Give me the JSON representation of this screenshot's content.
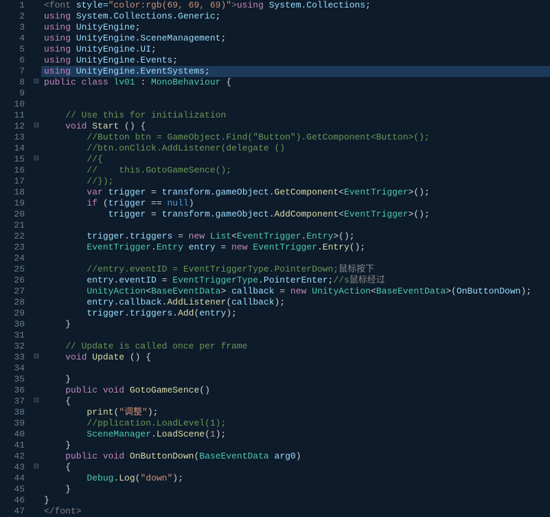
{
  "lines": [
    {
      "num": 1,
      "fold": "",
      "hl": false,
      "segs": [
        [
          "font-tag",
          "<font "
        ],
        [
          "font-attr",
          "style="
        ],
        [
          "font-val",
          "\"color:rgb(69, 69, 69)\""
        ],
        [
          "font-tag",
          ">"
        ],
        [
          "kw",
          "using "
        ],
        [
          "ns",
          "System.Collections"
        ],
        [
          "punc",
          ";"
        ]
      ]
    },
    {
      "num": 2,
      "fold": "",
      "hl": false,
      "segs": [
        [
          "kw",
          "using "
        ],
        [
          "ns",
          "System.Collections.Generic"
        ],
        [
          "punc",
          ";"
        ]
      ]
    },
    {
      "num": 3,
      "fold": "",
      "hl": false,
      "segs": [
        [
          "kw",
          "using "
        ],
        [
          "ns",
          "UnityEngine"
        ],
        [
          "punc",
          ";"
        ]
      ]
    },
    {
      "num": 4,
      "fold": "",
      "hl": false,
      "segs": [
        [
          "kw",
          "using "
        ],
        [
          "ns",
          "UnityEngine.SceneManagement"
        ],
        [
          "punc",
          ";"
        ]
      ]
    },
    {
      "num": 5,
      "fold": "",
      "hl": false,
      "segs": [
        [
          "kw",
          "using "
        ],
        [
          "ns",
          "UnityEngine.UI"
        ],
        [
          "punc",
          ";"
        ]
      ]
    },
    {
      "num": 6,
      "fold": "",
      "hl": false,
      "segs": [
        [
          "kw",
          "using "
        ],
        [
          "ns",
          "UnityEngine.Events"
        ],
        [
          "punc",
          ";"
        ]
      ]
    },
    {
      "num": 7,
      "fold": "",
      "hl": true,
      "segs": [
        [
          "kw",
          "using "
        ],
        [
          "ns",
          "UnityEngine.EventSystems"
        ],
        [
          "punc",
          ";"
        ]
      ]
    },
    {
      "num": 8,
      "fold": "⊟",
      "hl": false,
      "segs": [
        [
          "kw",
          "public class "
        ],
        [
          "type",
          "lv01"
        ],
        [
          "punc",
          " : "
        ],
        [
          "type",
          "MonoBehaviour"
        ],
        [
          "punc",
          " {"
        ]
      ]
    },
    {
      "num": 9,
      "fold": "",
      "hl": false,
      "segs": [
        [
          "punc",
          ""
        ]
      ]
    },
    {
      "num": 10,
      "fold": "",
      "hl": false,
      "segs": [
        [
          "punc",
          ""
        ]
      ]
    },
    {
      "num": 11,
      "fold": "",
      "hl": false,
      "segs": [
        [
          "punc",
          "    "
        ],
        [
          "comment",
          "// Use this for initialization"
        ]
      ]
    },
    {
      "num": 12,
      "fold": "⊟",
      "hl": false,
      "segs": [
        [
          "punc",
          "    "
        ],
        [
          "kw",
          "void "
        ],
        [
          "method",
          "Start"
        ],
        [
          "punc",
          " () {"
        ]
      ]
    },
    {
      "num": 13,
      "fold": "",
      "hl": false,
      "segs": [
        [
          "punc",
          "        "
        ],
        [
          "comment",
          "//Button btn = GameObject.Find(\"Button\").GetComponent<Button>();"
        ]
      ]
    },
    {
      "num": 14,
      "fold": "",
      "hl": false,
      "segs": [
        [
          "punc",
          "        "
        ],
        [
          "comment",
          "//btn.onClick.AddListener(delegate ()"
        ]
      ]
    },
    {
      "num": 15,
      "fold": "⊟",
      "hl": false,
      "segs": [
        [
          "punc",
          "        "
        ],
        [
          "comment",
          "//{"
        ]
      ]
    },
    {
      "num": 16,
      "fold": "",
      "hl": false,
      "segs": [
        [
          "punc",
          "        "
        ],
        [
          "comment",
          "//    this.GotoGameSence();"
        ]
      ]
    },
    {
      "num": 17,
      "fold": "",
      "hl": false,
      "segs": [
        [
          "punc",
          "        "
        ],
        [
          "comment",
          "//});"
        ]
      ]
    },
    {
      "num": 18,
      "fold": "",
      "hl": false,
      "segs": [
        [
          "punc",
          "        "
        ],
        [
          "kw",
          "var "
        ],
        [
          "ns",
          "trigger"
        ],
        [
          "punc",
          " = "
        ],
        [
          "ns",
          "transform"
        ],
        [
          "punc",
          "."
        ],
        [
          "ns",
          "gameObject"
        ],
        [
          "punc",
          "."
        ],
        [
          "method",
          "GetComponent"
        ],
        [
          "punc",
          "<"
        ],
        [
          "type",
          "EventTrigger"
        ],
        [
          "punc",
          ">();"
        ]
      ]
    },
    {
      "num": 19,
      "fold": "",
      "hl": false,
      "segs": [
        [
          "punc",
          "        "
        ],
        [
          "kw",
          "if "
        ],
        [
          "punc",
          "("
        ],
        [
          "ns",
          "trigger"
        ],
        [
          "punc",
          " == "
        ],
        [
          "null",
          "null"
        ],
        [
          "punc",
          ")"
        ]
      ]
    },
    {
      "num": 20,
      "fold": "",
      "hl": false,
      "segs": [
        [
          "punc",
          "            "
        ],
        [
          "ns",
          "trigger"
        ],
        [
          "punc",
          " = "
        ],
        [
          "ns",
          "transform"
        ],
        [
          "punc",
          "."
        ],
        [
          "ns",
          "gameObject"
        ],
        [
          "punc",
          "."
        ],
        [
          "method",
          "AddComponent"
        ],
        [
          "punc",
          "<"
        ],
        [
          "type",
          "EventTrigger"
        ],
        [
          "punc",
          ">();"
        ]
      ]
    },
    {
      "num": 21,
      "fold": "",
      "hl": false,
      "segs": [
        [
          "punc",
          ""
        ]
      ]
    },
    {
      "num": 22,
      "fold": "",
      "hl": false,
      "segs": [
        [
          "punc",
          "        "
        ],
        [
          "ns",
          "trigger"
        ],
        [
          "punc",
          "."
        ],
        [
          "ns",
          "triggers"
        ],
        [
          "punc",
          " = "
        ],
        [
          "kw",
          "new "
        ],
        [
          "type",
          "List"
        ],
        [
          "punc",
          "<"
        ],
        [
          "type",
          "EventTrigger"
        ],
        [
          "punc",
          "."
        ],
        [
          "type",
          "Entry"
        ],
        [
          "punc",
          ">();"
        ]
      ]
    },
    {
      "num": 23,
      "fold": "",
      "hl": false,
      "segs": [
        [
          "punc",
          "        "
        ],
        [
          "type",
          "EventTrigger"
        ],
        [
          "punc",
          "."
        ],
        [
          "type",
          "Entry"
        ],
        [
          "punc",
          " "
        ],
        [
          "ns",
          "entry"
        ],
        [
          "punc",
          " = "
        ],
        [
          "kw",
          "new "
        ],
        [
          "type",
          "EventTrigger"
        ],
        [
          "punc",
          "."
        ],
        [
          "method",
          "Entry"
        ],
        [
          "punc",
          "();"
        ]
      ]
    },
    {
      "num": 24,
      "fold": "",
      "hl": false,
      "segs": [
        [
          "punc",
          ""
        ]
      ]
    },
    {
      "num": 25,
      "fold": "",
      "hl": false,
      "segs": [
        [
          "punc",
          "        "
        ],
        [
          "comment",
          "//entry.eventID = EventTriggerType.PointerDown;"
        ],
        [
          "cn",
          "鼠标按下"
        ]
      ]
    },
    {
      "num": 26,
      "fold": "",
      "hl": false,
      "segs": [
        [
          "punc",
          "        "
        ],
        [
          "ns",
          "entry"
        ],
        [
          "punc",
          "."
        ],
        [
          "ns",
          "eventID"
        ],
        [
          "punc",
          " = "
        ],
        [
          "type",
          "EventTriggerType"
        ],
        [
          "punc",
          "."
        ],
        [
          "ns",
          "PointerEnter"
        ],
        [
          "punc",
          ";"
        ],
        [
          "comment",
          "//s"
        ],
        [
          "cn",
          "鼠标经过"
        ]
      ]
    },
    {
      "num": 27,
      "fold": "",
      "hl": false,
      "segs": [
        [
          "punc",
          "        "
        ],
        [
          "type",
          "UnityAction"
        ],
        [
          "punc",
          "<"
        ],
        [
          "type",
          "BaseEventData"
        ],
        [
          "punc",
          "> "
        ],
        [
          "ns",
          "callback"
        ],
        [
          "punc",
          " = "
        ],
        [
          "kw",
          "new "
        ],
        [
          "type",
          "UnityAction"
        ],
        [
          "punc",
          "<"
        ],
        [
          "type",
          "BaseEventData"
        ],
        [
          "punc",
          ">("
        ],
        [
          "ns",
          "OnButtonDown"
        ],
        [
          "punc",
          ");"
        ]
      ]
    },
    {
      "num": 28,
      "fold": "",
      "hl": false,
      "segs": [
        [
          "punc",
          "        "
        ],
        [
          "ns",
          "entry"
        ],
        [
          "punc",
          "."
        ],
        [
          "ns",
          "callback"
        ],
        [
          "punc",
          "."
        ],
        [
          "method",
          "AddListener"
        ],
        [
          "punc",
          "("
        ],
        [
          "ns",
          "callback"
        ],
        [
          "punc",
          ");"
        ]
      ]
    },
    {
      "num": 29,
      "fold": "",
      "hl": false,
      "segs": [
        [
          "punc",
          "        "
        ],
        [
          "ns",
          "trigger"
        ],
        [
          "punc",
          "."
        ],
        [
          "ns",
          "triggers"
        ],
        [
          "punc",
          "."
        ],
        [
          "method",
          "Add"
        ],
        [
          "punc",
          "("
        ],
        [
          "ns",
          "entry"
        ],
        [
          "punc",
          ");"
        ]
      ]
    },
    {
      "num": 30,
      "fold": "",
      "hl": false,
      "segs": [
        [
          "punc",
          "    }"
        ]
      ]
    },
    {
      "num": 31,
      "fold": "",
      "hl": false,
      "segs": [
        [
          "punc",
          ""
        ]
      ]
    },
    {
      "num": 32,
      "fold": "",
      "hl": false,
      "segs": [
        [
          "punc",
          "    "
        ],
        [
          "comment",
          "// Update is called once per frame"
        ]
      ]
    },
    {
      "num": 33,
      "fold": "⊟",
      "hl": false,
      "segs": [
        [
          "punc",
          "    "
        ],
        [
          "kw",
          "void "
        ],
        [
          "method",
          "Update"
        ],
        [
          "punc",
          " () {"
        ]
      ]
    },
    {
      "num": 34,
      "fold": "",
      "hl": false,
      "segs": [
        [
          "punc",
          ""
        ]
      ]
    },
    {
      "num": 35,
      "fold": "",
      "hl": false,
      "segs": [
        [
          "punc",
          "    }"
        ]
      ]
    },
    {
      "num": 36,
      "fold": "",
      "hl": false,
      "segs": [
        [
          "punc",
          "    "
        ],
        [
          "kw",
          "public void "
        ],
        [
          "method",
          "GotoGameSence"
        ],
        [
          "punc",
          "()"
        ]
      ]
    },
    {
      "num": 37,
      "fold": "⊟",
      "hl": false,
      "segs": [
        [
          "punc",
          "    {"
        ]
      ]
    },
    {
      "num": 38,
      "fold": "",
      "hl": false,
      "segs": [
        [
          "punc",
          "        "
        ],
        [
          "method",
          "print"
        ],
        [
          "punc",
          "("
        ],
        [
          "str",
          "\"调整\""
        ],
        [
          "punc",
          ");"
        ]
      ]
    },
    {
      "num": 39,
      "fold": "",
      "hl": false,
      "segs": [
        [
          "punc",
          "        "
        ],
        [
          "comment",
          "//pplication.LoadLevel(1);"
        ]
      ]
    },
    {
      "num": 40,
      "fold": "",
      "hl": false,
      "segs": [
        [
          "punc",
          "        "
        ],
        [
          "type",
          "SceneManager"
        ],
        [
          "punc",
          "."
        ],
        [
          "method",
          "LoadScene"
        ],
        [
          "punc",
          "("
        ],
        [
          "str",
          "1"
        ],
        [
          "punc",
          ");"
        ]
      ]
    },
    {
      "num": 41,
      "fold": "",
      "hl": false,
      "segs": [
        [
          "punc",
          "    }"
        ]
      ]
    },
    {
      "num": 42,
      "fold": "",
      "hl": false,
      "segs": [
        [
          "punc",
          "    "
        ],
        [
          "kw",
          "public void "
        ],
        [
          "method",
          "OnButtonDown"
        ],
        [
          "punc",
          "("
        ],
        [
          "type",
          "BaseEventData"
        ],
        [
          "punc",
          " "
        ],
        [
          "ns",
          "arg0"
        ],
        [
          "punc",
          ")"
        ]
      ]
    },
    {
      "num": 43,
      "fold": "⊟",
      "hl": false,
      "segs": [
        [
          "punc",
          "    {"
        ]
      ]
    },
    {
      "num": 44,
      "fold": "",
      "hl": false,
      "segs": [
        [
          "punc",
          "        "
        ],
        [
          "type",
          "Debug"
        ],
        [
          "punc",
          "."
        ],
        [
          "method",
          "Log"
        ],
        [
          "punc",
          "("
        ],
        [
          "str",
          "\"down\""
        ],
        [
          "punc",
          ");"
        ]
      ]
    },
    {
      "num": 45,
      "fold": "",
      "hl": false,
      "segs": [
        [
          "punc",
          "    }"
        ]
      ]
    },
    {
      "num": 46,
      "fold": "",
      "hl": false,
      "segs": [
        [
          "punc",
          "}"
        ]
      ]
    },
    {
      "num": 47,
      "fold": "",
      "hl": false,
      "segs": [
        [
          "font-tag",
          "</font>"
        ]
      ]
    }
  ]
}
